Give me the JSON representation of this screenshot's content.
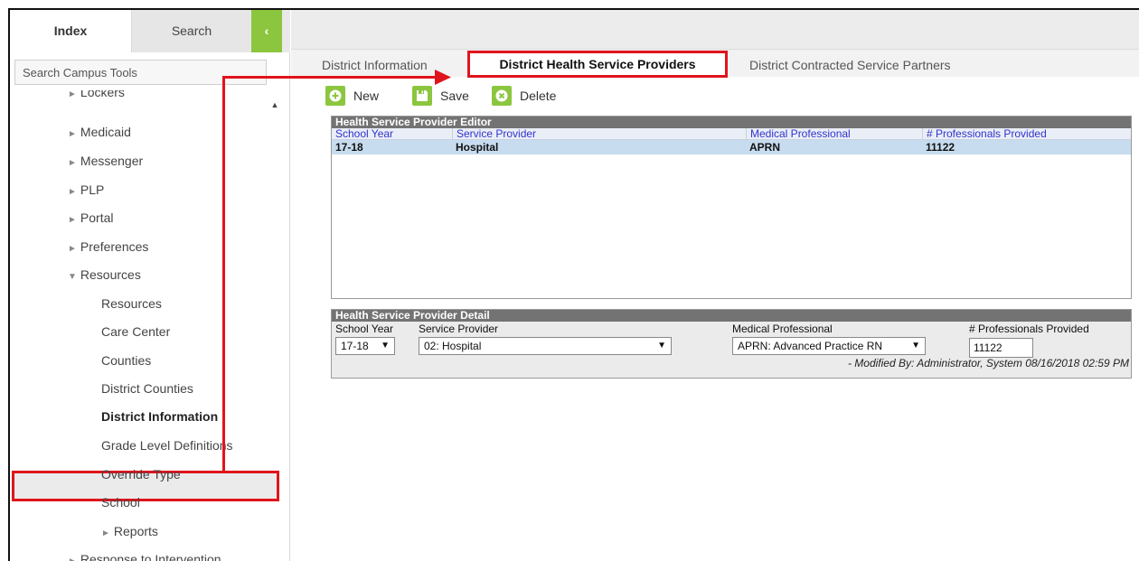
{
  "sidebar": {
    "tabs": {
      "index": "Index",
      "search": "Search"
    },
    "collapse_icon": "‹",
    "search_placeholder": "Search Campus Tools",
    "scroll_up_icon": "▲",
    "tree": [
      {
        "label": "Lockers",
        "arrow": "►",
        "indent": 0
      },
      {
        "label": "Medicaid",
        "arrow": "►",
        "indent": 0
      },
      {
        "label": "Messenger",
        "arrow": "►",
        "indent": 0
      },
      {
        "label": "PLP",
        "arrow": "►",
        "indent": 0
      },
      {
        "label": "Portal",
        "arrow": "►",
        "indent": 0
      },
      {
        "label": "Preferences",
        "arrow": "►",
        "indent": 0
      },
      {
        "label": "Resources",
        "arrow": "▼",
        "indent": 0
      },
      {
        "label": "Resources",
        "arrow": "",
        "indent": 1
      },
      {
        "label": "Care Center",
        "arrow": "",
        "indent": 1
      },
      {
        "label": "Counties",
        "arrow": "",
        "indent": 1
      },
      {
        "label": "District Counties",
        "arrow": "",
        "indent": 1
      },
      {
        "label": "District Information",
        "arrow": "",
        "indent": 1
      },
      {
        "label": "Grade Level Definitions",
        "arrow": "",
        "indent": 1
      },
      {
        "label": "Override Type",
        "arrow": "",
        "indent": 1
      },
      {
        "label": "School",
        "arrow": "",
        "indent": 1
      },
      {
        "label": "Reports",
        "arrow": "►",
        "indent": 1
      },
      {
        "label": "Response to Intervention",
        "arrow": "►",
        "indent": 0
      }
    ]
  },
  "main": {
    "tabs": [
      "District Information",
      "District Health Service Providers",
      "District Contracted Service Partners"
    ],
    "toolbar": {
      "new": "New",
      "save": "Save",
      "delete": "Delete"
    },
    "editor": {
      "title": "Health Service Provider Editor",
      "columns": [
        "School Year",
        "Service Provider",
        "Medical Professional",
        "# Professionals Provided"
      ],
      "rows": [
        [
          "17-18",
          "Hospital",
          "APRN",
          "11122"
        ]
      ]
    },
    "detail": {
      "title": "Health Service Provider Detail",
      "labels": {
        "school_year": "School Year",
        "service_provider": "Service Provider",
        "medical_professional": "Medical Professional",
        "professionals_provided": "# Professionals Provided"
      },
      "values": {
        "school_year": "17-18",
        "service_provider": "02: Hospital",
        "medical_professional": "APRN: Advanced Practice RN",
        "professionals_provided": "11122"
      },
      "caret": "▼",
      "modified": "- Modified By: Administrator, System 08/16/2018 02:59 PM"
    }
  },
  "colors": {
    "accent_green": "#8cc63f",
    "highlight_red": "#e0141c",
    "panel_header": "#737373",
    "selected_row": "#c7dcef",
    "column_link": "#3333cc"
  }
}
